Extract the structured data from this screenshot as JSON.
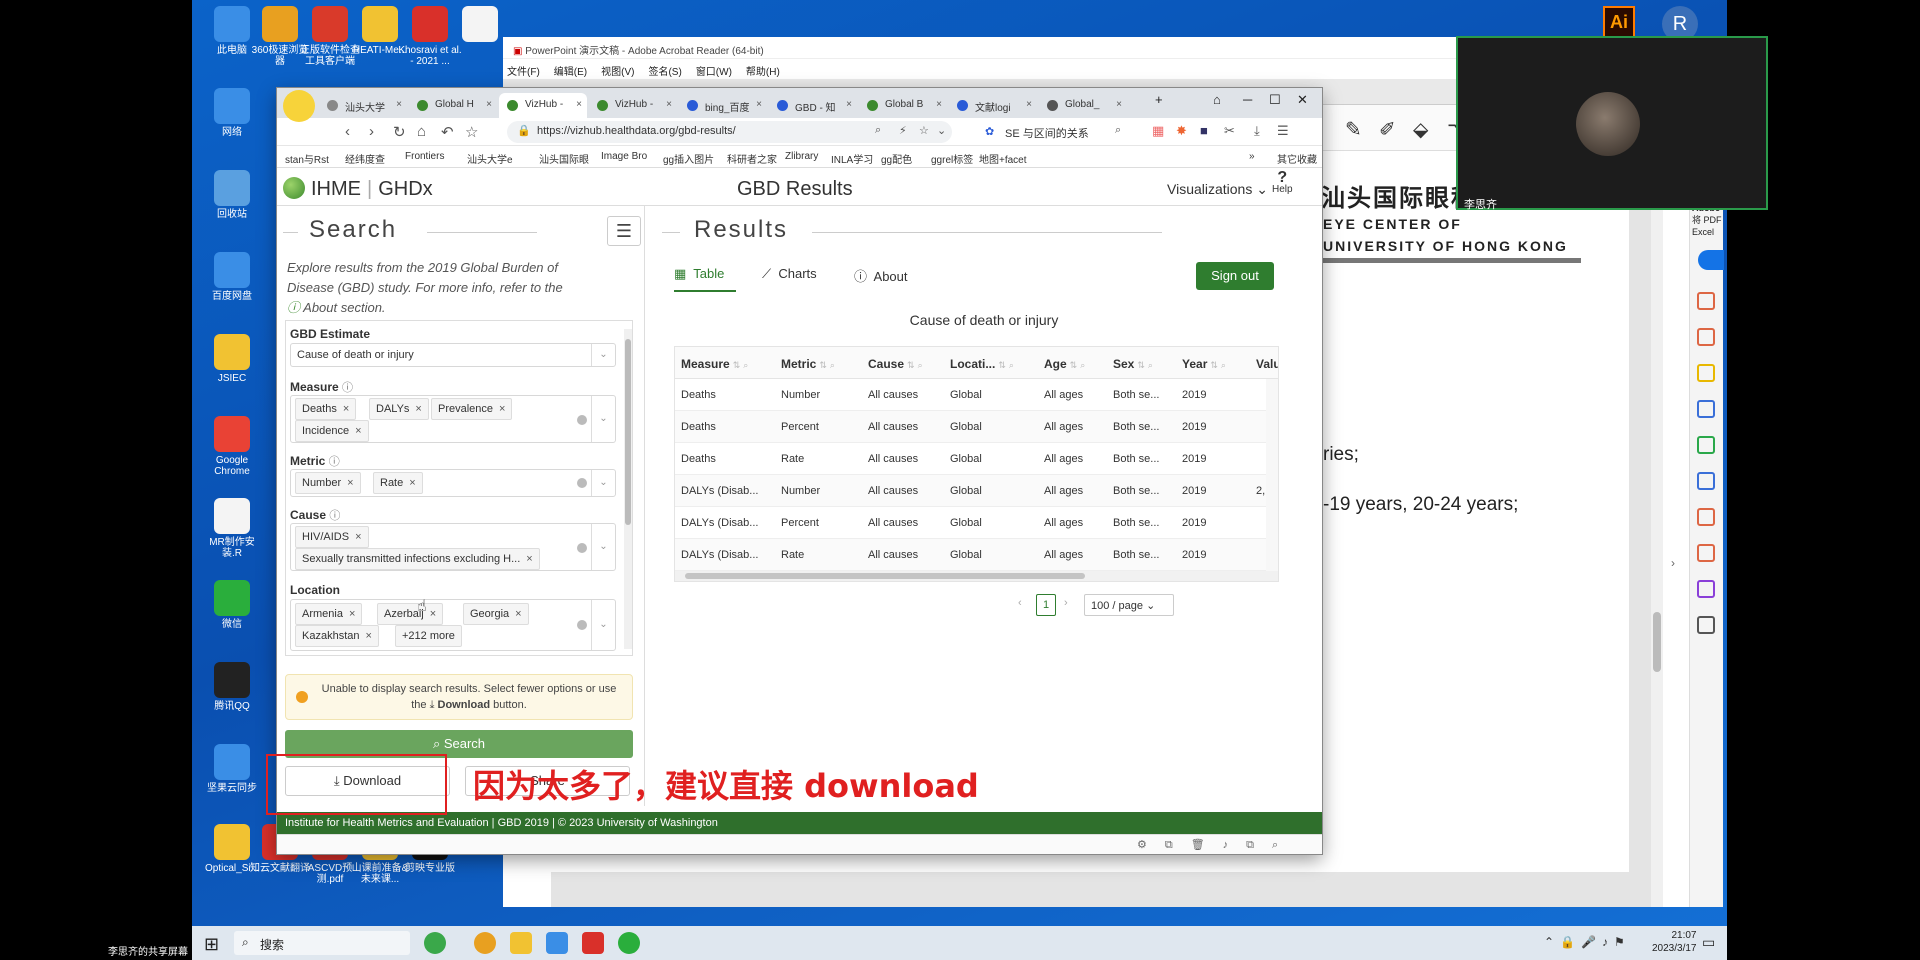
{
  "desktop": {
    "icons": [
      {
        "label": "此电脑",
        "color": "#3a8ee6"
      },
      {
        "label": "360极速浏览器",
        "color": "#e8a020"
      },
      {
        "label": "正版软件检查工具客户端",
        "color": "#d93a2a"
      },
      {
        "label": "HEATI-Me...",
        "color": "#f1c232"
      },
      {
        "label": "Khosravi et al. - 2021 ...",
        "color": "#d9302a"
      },
      {
        "label": "",
        "color": "#f4f4f4"
      },
      {
        "label": "网络",
        "color": "#3a8ee6"
      },
      {
        "label": "回收站",
        "color": "#5aa0e0"
      },
      {
        "label": "百度网盘",
        "color": "#3a8ee6"
      },
      {
        "label": "JSIEC",
        "color": "#f1c232"
      },
      {
        "label": "Google Chrome",
        "color": "#e94235"
      },
      {
        "label": "MR制作安装.R",
        "color": "#f4f4f4"
      },
      {
        "label": "微信",
        "color": "#2aae3c"
      },
      {
        "label": "腾讯QQ",
        "color": "#222222"
      },
      {
        "label": "坚果云同步",
        "color": "#3a8ee6"
      },
      {
        "label": "Optical_Si...",
        "color": "#f1c232"
      },
      {
        "label": "知云文献翻译",
        "color": "#d9302a"
      },
      {
        "label": "ASCVD预测.pdf",
        "color": "#d9302a"
      },
      {
        "label": "山课前准备&未来课...",
        "color": "#f1c232"
      },
      {
        "label": "剪映专业版",
        "color": "#111111"
      }
    ],
    "share_label": "李思齐的共享屏幕"
  },
  "acrobat": {
    "title": "PowerPoint 演示文稿 - Adobe Acrobat Reader (64-bit)",
    "menu": [
      "文件(F)",
      "编辑(E)",
      "视图(V)",
      "签名(S)",
      "窗口(W)",
      "帮助(H)"
    ],
    "doc_title_cn": "汕头国际眼科中心",
    "doc_title_en1": "EYE CENTER OF",
    "doc_title_en2": "UNIVERSITY OF HONG KONG",
    "doc_line1": "ries;",
    "doc_line2": "-19 years, 20-24 years;",
    "right_label1": "Adobe",
    "right_label2": "将 PDF",
    "right_label3": "Excel"
  },
  "video": {
    "name": "李思齐"
  },
  "browser": {
    "tabs": [
      {
        "label": "汕头大学",
        "color": "#888888"
      },
      {
        "label": "Global H",
        "color": "#3c8a2e"
      },
      {
        "label": "VizHub -",
        "color": "#3c8a2e"
      },
      {
        "label": "VizHub -",
        "color": "#3c8a2e"
      },
      {
        "label": "bing_百度",
        "color": "#2a5bd7"
      },
      {
        "label": "GBD - 知",
        "color": "#2a5bd7"
      },
      {
        "label": "Global B",
        "color": "#3c8a2e"
      },
      {
        "label": "文献logi",
        "color": "#2a5bd7"
      },
      {
        "label": "Global_",
        "color": "#555555"
      }
    ],
    "url": "https://vizhub.healthdata.org/gbd-results/",
    "search_box": "SE 与区间的关系",
    "bookmarks": [
      "stan与Rst",
      "经纬度查",
      "Frontiers",
      "汕头大学e",
      "汕头国际眼",
      "Image Bro",
      "gg插入图片",
      "科研者之家",
      "Zlibrary",
      "INLA学习",
      "gg配色",
      "ggrel标签",
      "地图+facet",
      "»",
      "其它收藏"
    ]
  },
  "ghdx": {
    "brand_left": "IHME",
    "brand_right": "GHDx",
    "title": "GBD Results",
    "visualizations": "Visualizations",
    "help": "Help",
    "search": {
      "heading": "Search",
      "intro": "Explore results from the 2019 Global Burden of Disease (GBD) study. For more info, refer to the",
      "intro_link": "About section.",
      "estimate_label": "GBD Estimate",
      "estimate_value": "Cause of death or injury",
      "measure_label": "Measure",
      "measures": [
        "Deaths",
        "DALYs",
        "Prevalence",
        "Incidence"
      ],
      "metric_label": "Metric",
      "metrics": [
        "Number",
        "Rate"
      ],
      "cause_label": "Cause",
      "causes": [
        "HIV/AIDS",
        "Sexually transmitted infections excluding H..."
      ],
      "location_label": "Location",
      "locations": [
        "Armenia",
        "Azerbaij",
        "Georgia",
        "Kazakhstan"
      ],
      "more_locations": "+212 more",
      "warning_a": "Unable to display search results. Select fewer options or use the",
      "warning_b": "Download",
      "warning_c": "button.",
      "search_button": "Search",
      "download_button": "Download",
      "share_button": "Share"
    },
    "results": {
      "heading": "Results",
      "tabs": [
        "Table",
        "Charts",
        "About"
      ],
      "sign_out": "Sign out",
      "table_title": "Cause of death or injury",
      "columns": [
        "Measure",
        "Metric",
        "Cause",
        "Locati...",
        "Age",
        "Sex",
        "Year",
        "Valu"
      ],
      "rows": [
        [
          "Deaths",
          "Number",
          "All causes",
          "Global",
          "All ages",
          "Both se...",
          "2019",
          ""
        ],
        [
          "Deaths",
          "Percent",
          "All causes",
          "Global",
          "All ages",
          "Both se...",
          "2019",
          ""
        ],
        [
          "Deaths",
          "Rate",
          "All causes",
          "Global",
          "All ages",
          "Both se...",
          "2019",
          ""
        ],
        [
          "DALYs (Disab...",
          "Number",
          "All causes",
          "Global",
          "All ages",
          "Both se...",
          "2019",
          "2,"
        ],
        [
          "DALYs (Disab...",
          "Percent",
          "All causes",
          "Global",
          "All ages",
          "Both se...",
          "2019",
          ""
        ],
        [
          "DALYs (Disab...",
          "Rate",
          "All causes",
          "Global",
          "All ages",
          "Both se...",
          "2019",
          ""
        ]
      ],
      "page": "1",
      "page_size": "100 / page"
    },
    "footer": "Institute for Health Metrics and Evaluation  |  GBD 2019  |  © 2023 University of Washington"
  },
  "annotation": {
    "text": "因为太多了，建议直接 download"
  },
  "taskbar": {
    "search": "搜索",
    "time": "21:07",
    "date": "2023/3/17"
  }
}
